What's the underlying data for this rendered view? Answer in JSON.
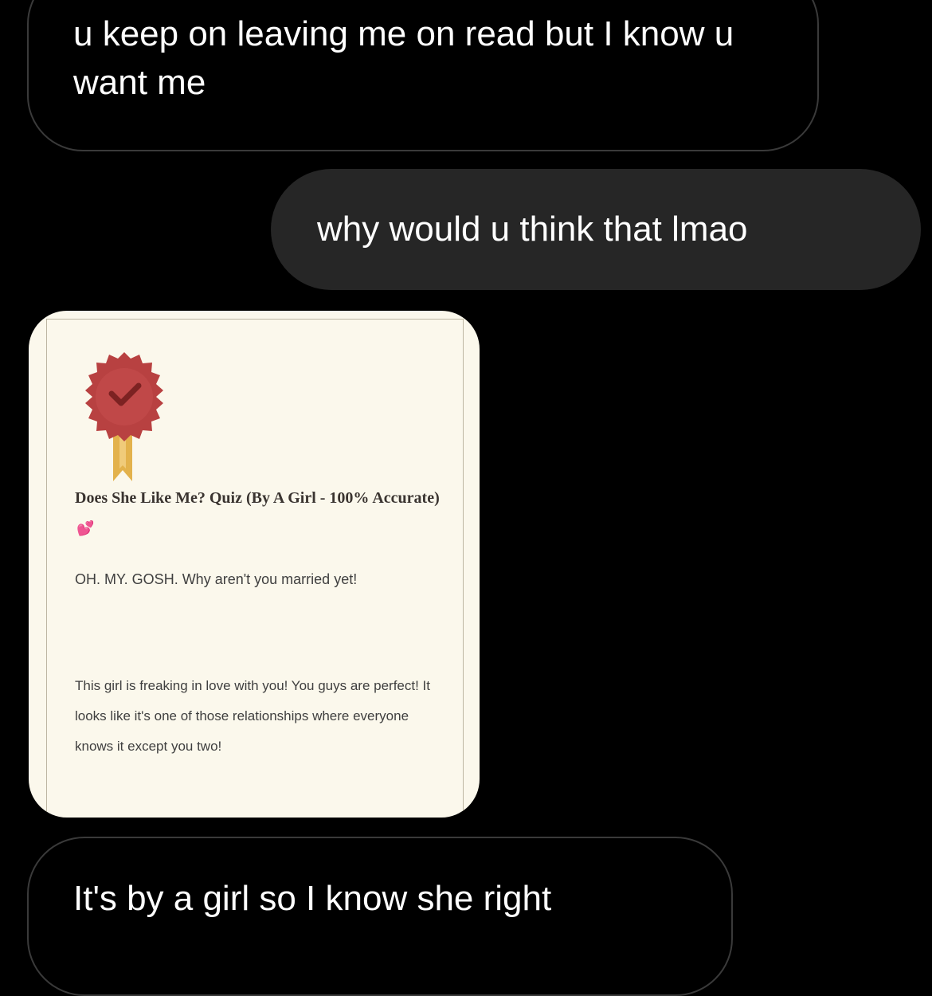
{
  "messages": [
    {
      "direction": "incoming",
      "text": "u keep on leaving me on read but I know u want me"
    },
    {
      "direction": "outgoing",
      "text": "why would u think that lmao"
    },
    {
      "direction": "incoming",
      "type": "image"
    },
    {
      "direction": "incoming",
      "text": "It's by a girl so I know she right"
    }
  ],
  "quiz_card": {
    "badge_icon": "award-ribbon-check-icon",
    "title": "Does She Like Me? Quiz (By A Girl - 100% Accurate)",
    "title_emoji": "💕",
    "result_heading": "OH. MY. GOSH. Why aren't you married yet!",
    "result_text": "This girl is freaking in love with you! You guys are perfect! It looks like it's one of those relationships where everyone knows it except you two!"
  },
  "colors": {
    "background": "#000000",
    "outgoing_bubble": "#262626",
    "incoming_border": "#3a3a3a",
    "card_background": "#fbf8ec",
    "badge_red": "#b84141",
    "ribbon_gold": "#e3b24c"
  }
}
